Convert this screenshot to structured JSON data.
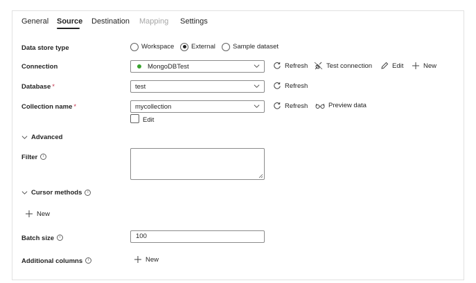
{
  "tabs": [
    {
      "label": "General",
      "state": "normal"
    },
    {
      "label": "Source",
      "state": "active"
    },
    {
      "label": "Destination",
      "state": "normal"
    },
    {
      "label": "Mapping",
      "state": "disabled"
    },
    {
      "label": "Settings",
      "state": "normal"
    }
  ],
  "data_store_type": {
    "label": "Data store type",
    "options": [
      "Workspace",
      "External",
      "Sample dataset"
    ],
    "selected": "External"
  },
  "connection": {
    "label": "Connection",
    "value": "MongoDBTest",
    "status_color": "#3aa32f",
    "refresh": "Refresh",
    "test": "Test connection",
    "edit": "Edit",
    "new": "New"
  },
  "database": {
    "label": "Database",
    "required_mark": "*",
    "value": "test",
    "refresh": "Refresh"
  },
  "collection": {
    "label": "Collection name",
    "required_mark": "*",
    "value": "mycollection",
    "refresh": "Refresh",
    "preview": "Preview data",
    "edit_checkbox_label": "Edit",
    "edit_checked": false
  },
  "advanced": {
    "label": "Advanced",
    "expanded": true
  },
  "filter": {
    "label": "Filter",
    "info": "i",
    "value": ""
  },
  "cursor_methods": {
    "label": "Cursor methods",
    "info": "i",
    "new": "New",
    "expanded": true
  },
  "batch_size": {
    "label": "Batch size",
    "info": "i",
    "value": "100"
  },
  "additional_columns": {
    "label": "Additional columns",
    "info": "i",
    "new": "New"
  }
}
